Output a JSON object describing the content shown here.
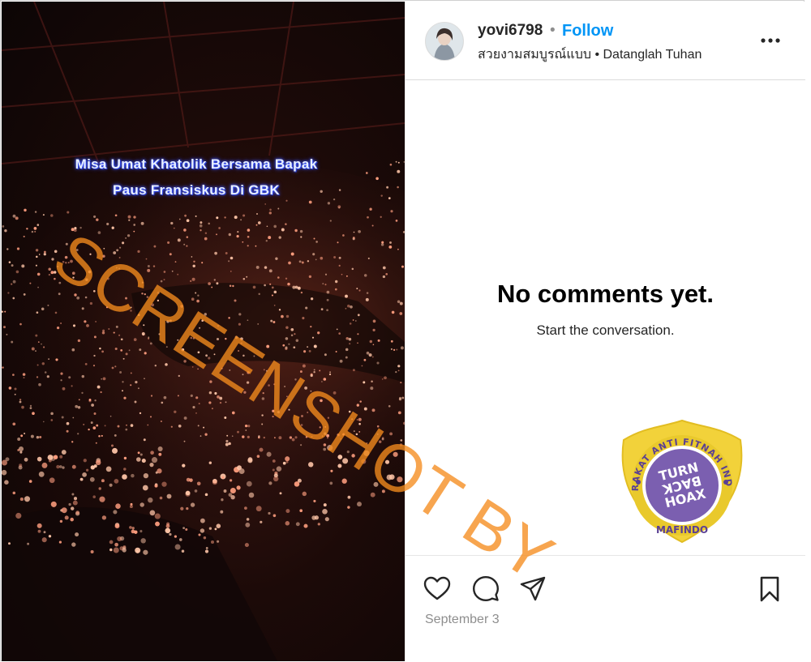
{
  "post": {
    "media": {
      "caption_line1": "Misa Umat Khatolik  Bersama Bapak",
      "caption_line2": "Paus Fransiskus Di GBK"
    },
    "header": {
      "username": "yovi6798",
      "separator": "•",
      "follow_label": "Follow",
      "subline": "สวยงามสมบูรณ์แบบ • Datanglah Tuhan",
      "more_icon": "more-horizontal-icon"
    },
    "comments": {
      "empty_title": "No comments yet.",
      "empty_subtitle": "Start the conversation."
    },
    "actions": {
      "like_icon": "heart-icon",
      "comment_icon": "comment-icon",
      "share_icon": "send-icon",
      "save_icon": "bookmark-icon",
      "date": "September 3"
    }
  },
  "overlay": {
    "watermark_text": "SCREENSHOT BY",
    "badge": {
      "ring_text": "MASYARAKAT ANTI FITNAH INDONESIA",
      "bottom_text": "MAFINDO",
      "line1": "TURN",
      "line2": "BACK",
      "line3": "HOAX"
    },
    "colors": {
      "watermark": "#f58c1e",
      "badge_gold": "#f2d23a",
      "badge_purple": "#7b5fb0",
      "follow_blue": "#0095f6"
    }
  }
}
